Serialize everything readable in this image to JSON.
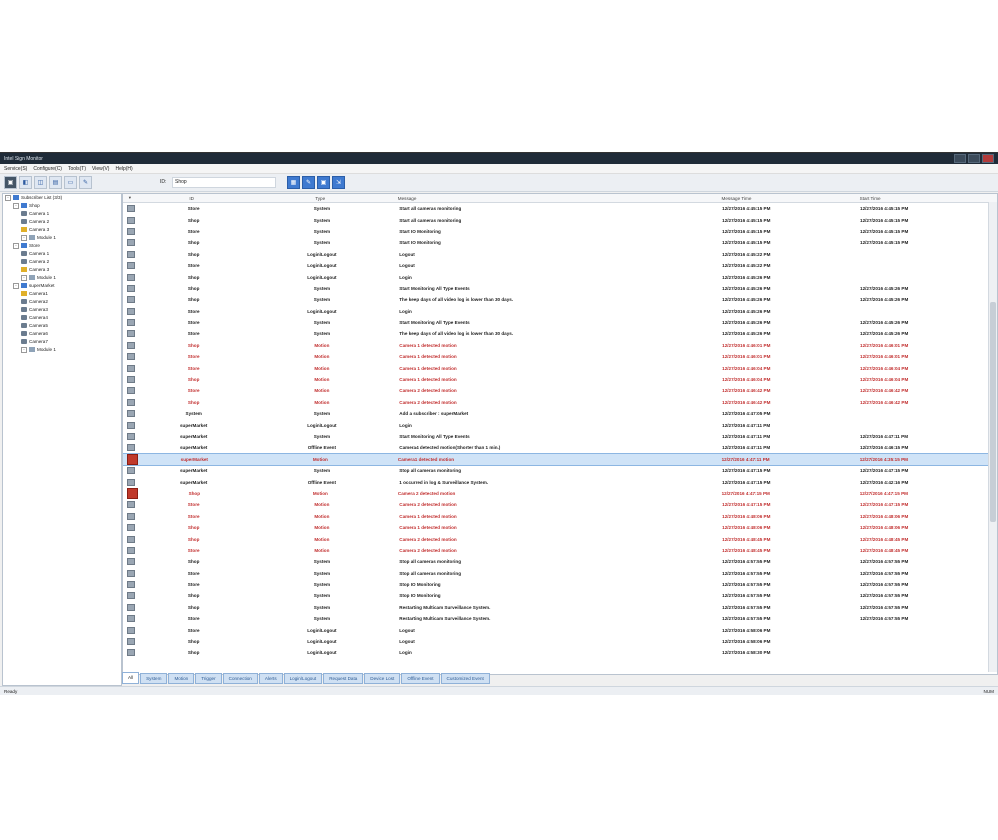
{
  "window": {
    "title": "Intel Sign Monitor"
  },
  "menu": [
    "Service(S)",
    "Configure(C)",
    "Tools(T)",
    "View(V)",
    "Help(H)"
  ],
  "toolbar": {
    "id_label": "ID:",
    "id_value": "Shop"
  },
  "tree": [
    {
      "label": "Subscriber List (3/3)",
      "level": 0,
      "icon": "group"
    },
    {
      "label": "Shop",
      "level": 1,
      "icon": "group"
    },
    {
      "label": "Camera 1",
      "level": 2,
      "icon": "camera"
    },
    {
      "label": "Camera 2",
      "level": 2,
      "icon": "camera"
    },
    {
      "label": "Camera 3",
      "level": 2,
      "icon": "camera-alert"
    },
    {
      "label": "Module 1",
      "level": 2,
      "icon": "module"
    },
    {
      "label": "Store",
      "level": 1,
      "icon": "group"
    },
    {
      "label": "Camera 1",
      "level": 2,
      "icon": "camera"
    },
    {
      "label": "Camera 2",
      "level": 2,
      "icon": "camera"
    },
    {
      "label": "Camera 3",
      "level": 2,
      "icon": "camera-alert"
    },
    {
      "label": "Module 1",
      "level": 2,
      "icon": "module"
    },
    {
      "label": "superMarket",
      "level": 1,
      "icon": "group"
    },
    {
      "label": "Camera1",
      "level": 2,
      "icon": "camera-alert"
    },
    {
      "label": "Camera2",
      "level": 2,
      "icon": "camera"
    },
    {
      "label": "Camera3",
      "level": 2,
      "icon": "camera"
    },
    {
      "label": "Camera4",
      "level": 2,
      "icon": "camera"
    },
    {
      "label": "Camera5",
      "level": 2,
      "icon": "camera"
    },
    {
      "label": "Camera6",
      "level": 2,
      "icon": "camera"
    },
    {
      "label": "Camera7",
      "level": 2,
      "icon": "camera"
    },
    {
      "label": "Module 1",
      "level": 2,
      "icon": "module"
    }
  ],
  "table": {
    "headers": {
      "id": "ID",
      "type": "Type",
      "message": "Message",
      "message_time": "Message Time",
      "start_time": "Start Time"
    },
    "rows": [
      {
        "id": "Store",
        "type": "System",
        "message": "Start all cameras monitoring",
        "mtime": "12/27/2016 4:45:15 PM",
        "stime": "12/27/2016 4:45:15 PM",
        "style": "normal"
      },
      {
        "id": "Shop",
        "type": "System",
        "message": "Start all cameras monitoring",
        "mtime": "12/27/2016 4:45:15 PM",
        "stime": "12/27/2016 4:45:15 PM",
        "style": "normal"
      },
      {
        "id": "Store",
        "type": "System",
        "message": "Start IO Monitoring",
        "mtime": "12/27/2016 4:45:15 PM",
        "stime": "12/27/2016 4:45:15 PM",
        "style": "normal"
      },
      {
        "id": "Shop",
        "type": "System",
        "message": "Start IO Monitoring",
        "mtime": "12/27/2016 4:45:15 PM",
        "stime": "12/27/2016 4:45:15 PM",
        "style": "normal"
      },
      {
        "id": "Shop",
        "type": "Login\\Logout",
        "message": "Logout",
        "mtime": "12/27/2016 4:45:22 PM",
        "stime": "",
        "style": "normal"
      },
      {
        "id": "Store",
        "type": "Login\\Logout",
        "message": "Logout",
        "mtime": "12/27/2016 4:45:22 PM",
        "stime": "",
        "style": "normal"
      },
      {
        "id": "Shop",
        "type": "Login\\Logout",
        "message": "Login",
        "mtime": "12/27/2016 4:45:26 PM",
        "stime": "",
        "style": "normal"
      },
      {
        "id": "Shop",
        "type": "System",
        "message": "Start Monitoring All Type Events",
        "mtime": "12/27/2016 4:45:26 PM",
        "stime": "12/27/2016 4:45:26 PM",
        "style": "normal"
      },
      {
        "id": "Shop",
        "type": "System",
        "message": "The keep days of all video log is lower than 30 days.",
        "mtime": "12/27/2016 4:45:26 PM",
        "stime": "12/27/2016 4:45:26 PM",
        "style": "normal"
      },
      {
        "id": "Store",
        "type": "Login\\Logout",
        "message": "Login",
        "mtime": "12/27/2016 4:45:26 PM",
        "stime": "",
        "style": "normal"
      },
      {
        "id": "Store",
        "type": "System",
        "message": "Start Monitoring All Type Events",
        "mtime": "12/27/2016 4:45:26 PM",
        "stime": "12/27/2016 4:45:26 PM",
        "style": "normal"
      },
      {
        "id": "Store",
        "type": "System",
        "message": "The keep days of all video log is lower than 30 days.",
        "mtime": "12/27/2016 4:45:26 PM",
        "stime": "12/27/2016 4:45:26 PM",
        "style": "normal"
      },
      {
        "id": "Shop",
        "type": "Motion",
        "message": "Camera 1 detected motion",
        "mtime": "12/27/2016 4:46:01 PM",
        "stime": "12/27/2016 4:46:01 PM",
        "style": "motion"
      },
      {
        "id": "Store",
        "type": "Motion",
        "message": "Camera 1 detected motion",
        "mtime": "12/27/2016 4:46:01 PM",
        "stime": "12/27/2016 4:46:01 PM",
        "style": "motion"
      },
      {
        "id": "Store",
        "type": "Motion",
        "message": "Camera 1 detected motion",
        "mtime": "12/27/2016 4:46:04 PM",
        "stime": "12/27/2016 4:46:04 PM",
        "style": "motion"
      },
      {
        "id": "Shop",
        "type": "Motion",
        "message": "Camera 1 detected motion",
        "mtime": "12/27/2016 4:46:04 PM",
        "stime": "12/27/2016 4:46:04 PM",
        "style": "motion"
      },
      {
        "id": "Store",
        "type": "Motion",
        "message": "Camera 2 detected motion",
        "mtime": "12/27/2016 4:46:42 PM",
        "stime": "12/27/2016 4:46:42 PM",
        "style": "motion"
      },
      {
        "id": "Shop",
        "type": "Motion",
        "message": "Camera 2 detected motion",
        "mtime": "12/27/2016 4:46:42 PM",
        "stime": "12/27/2016 4:46:42 PM",
        "style": "motion"
      },
      {
        "id": "System",
        "type": "System",
        "message": "Add a subscriber : superMarket",
        "mtime": "12/27/2016 4:47:05 PM",
        "stime": "",
        "style": "normal"
      },
      {
        "id": "superMarket",
        "type": "Login\\Logout",
        "message": "Login",
        "mtime": "12/27/2016 4:47:11 PM",
        "stime": "",
        "style": "normal"
      },
      {
        "id": "superMarket",
        "type": "System",
        "message": "Start Monitoring All Type Events",
        "mtime": "12/27/2016 4:47:11 PM",
        "stime": "12/27/2016 4:47:11 PM",
        "style": "normal"
      },
      {
        "id": "superMarket",
        "type": "Offline Event",
        "message": "Camera4 detected motion(Shorter than 1 min.)",
        "mtime": "12/27/2016 4:47:11 PM",
        "stime": "12/27/2016 4:46:15 PM",
        "style": "normal"
      },
      {
        "id": "superMarket",
        "type": "Motion",
        "message": "Camera1 detected motion",
        "mtime": "12/27/2016 4:47:11 PM",
        "stime": "12/27/2016 4:35:15 PM",
        "style": "selected",
        "alert": true
      },
      {
        "id": "superMarket",
        "type": "System",
        "message": "Stop all cameras monitoring",
        "mtime": "12/27/2016 4:47:15 PM",
        "stime": "12/27/2016 4:47:15 PM",
        "style": "normal"
      },
      {
        "id": "superMarket",
        "type": "Offline Event",
        "message": "1 occurred in log & Surveillance System.",
        "mtime": "12/27/2016 4:47:15 PM",
        "stime": "12/27/2016 4:42:16 PM",
        "style": "normal"
      },
      {
        "id": "Shop",
        "type": "Motion",
        "message": "Camera 2 detected motion",
        "mtime": "12/27/2016 4:47:15 PM",
        "stime": "12/27/2016 4:47:15 PM",
        "style": "motion",
        "alert": true
      },
      {
        "id": "Store",
        "type": "Motion",
        "message": "Camera 2 detected motion",
        "mtime": "12/27/2016 4:47:15 PM",
        "stime": "12/27/2016 4:47:15 PM",
        "style": "motion"
      },
      {
        "id": "Store",
        "type": "Motion",
        "message": "Camera 1 detected motion",
        "mtime": "12/27/2016 4:48:06 PM",
        "stime": "12/27/2016 4:48:06 PM",
        "style": "motion"
      },
      {
        "id": "Shop",
        "type": "Motion",
        "message": "Camera 1 detected motion",
        "mtime": "12/27/2016 4:48:06 PM",
        "stime": "12/27/2016 4:48:06 PM",
        "style": "motion"
      },
      {
        "id": "Shop",
        "type": "Motion",
        "message": "Camera 2 detected motion",
        "mtime": "12/27/2016 4:48:45 PM",
        "stime": "12/27/2016 4:48:45 PM",
        "style": "motion"
      },
      {
        "id": "Store",
        "type": "Motion",
        "message": "Camera 2 detected motion",
        "mtime": "12/27/2016 4:48:45 PM",
        "stime": "12/27/2016 4:48:45 PM",
        "style": "motion"
      },
      {
        "id": "Shop",
        "type": "System",
        "message": "Stop all cameras monitoring",
        "mtime": "12/27/2016 4:57:55 PM",
        "stime": "12/27/2016 4:57:55 PM",
        "style": "normal"
      },
      {
        "id": "Store",
        "type": "System",
        "message": "Stop all cameras monitoring",
        "mtime": "12/27/2016 4:57:55 PM",
        "stime": "12/27/2016 4:57:55 PM",
        "style": "normal"
      },
      {
        "id": "Store",
        "type": "System",
        "message": "Stop IO Monitoring",
        "mtime": "12/27/2016 4:57:55 PM",
        "stime": "12/27/2016 4:57:55 PM",
        "style": "normal"
      },
      {
        "id": "Shop",
        "type": "System",
        "message": "Stop IO Monitoring",
        "mtime": "12/27/2016 4:57:55 PM",
        "stime": "12/27/2016 4:57:55 PM",
        "style": "normal"
      },
      {
        "id": "Shop",
        "type": "System",
        "message": "Restarting Multicam Surveillance System.",
        "mtime": "12/27/2016 4:57:55 PM",
        "stime": "12/27/2016 4:57:55 PM",
        "style": "normal"
      },
      {
        "id": "Store",
        "type": "System",
        "message": "Restarting Multicam Surveillance System.",
        "mtime": "12/27/2016 4:57:55 PM",
        "stime": "12/27/2016 4:57:55 PM",
        "style": "normal"
      },
      {
        "id": "Store",
        "type": "Login\\Logout",
        "message": "Logout",
        "mtime": "12/27/2016 4:58:06 PM",
        "stime": "",
        "style": "normal"
      },
      {
        "id": "Shop",
        "type": "Login\\Logout",
        "message": "Logout",
        "mtime": "12/27/2016 4:58:06 PM",
        "stime": "",
        "style": "normal"
      },
      {
        "id": "Shop",
        "type": "Login\\Logout",
        "message": "Login",
        "mtime": "12/27/2016 4:58:30 PM",
        "stime": "",
        "style": "normal"
      }
    ]
  },
  "tabs": [
    "All",
    "System",
    "Motion",
    "Trigger",
    "Connection",
    "Alerts",
    "Login\\Logout",
    "Request Data",
    "Device Lost",
    "Offline Event",
    "Customized Event"
  ],
  "status": {
    "left": "Ready",
    "right": "NUM"
  }
}
